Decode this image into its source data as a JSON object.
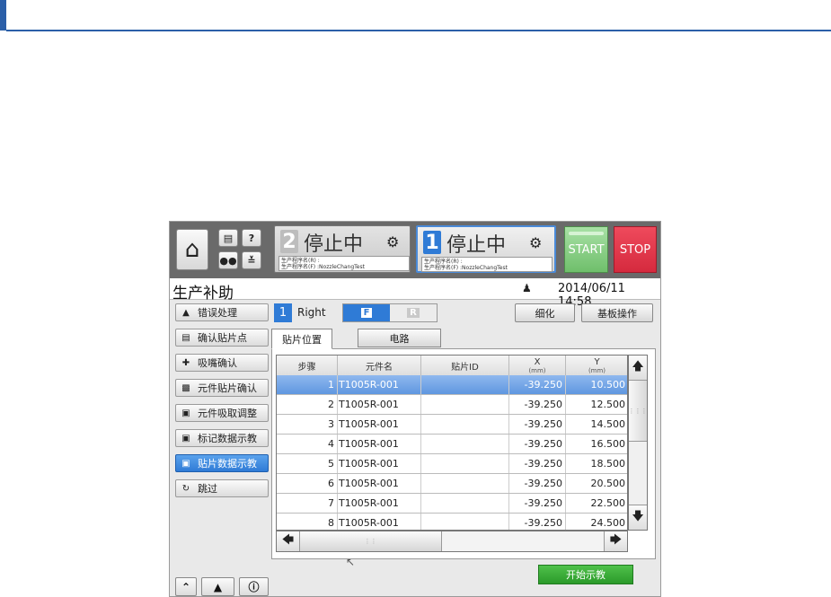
{
  "header": {
    "machine2": {
      "number": "2",
      "status": "停止中",
      "robot_icon": "robot-icon",
      "program_r": "生产程序名(R) :",
      "program_f": "生产程序名(F) :NozzleChangTest"
    },
    "machine1": {
      "number": "1",
      "status": "停止中",
      "robot_icon": "robot-icon",
      "program_r": "生产程序名(R) :",
      "program_f": "生产程序名(F) :NozzleChangTest"
    },
    "start_label": "START",
    "stop_label": "STOP",
    "home_icon": "home-icon",
    "small_buttons": [
      "keyboard-icon",
      "help-icon",
      "operator-icon",
      "network-icon"
    ]
  },
  "title": {
    "page_title": "生产补助",
    "datetime": "2014/06/11 14:58",
    "user_icon": "user-icon"
  },
  "nav": {
    "items": [
      {
        "label": "错误处理",
        "icon": "error-handling-icon"
      },
      {
        "label": "确认贴片点",
        "icon": "confirm-point-icon"
      },
      {
        "label": "吸嘴确认",
        "icon": "nozzle-icon"
      },
      {
        "label": "元件贴片确认",
        "icon": "component-icon"
      },
      {
        "label": "元件吸取调整",
        "icon": "pickup-icon"
      },
      {
        "label": "标记数据示教",
        "icon": "mark-icon"
      },
      {
        "label": "贴片数据示教",
        "icon": "placement-icon"
      },
      {
        "label": "跳过",
        "icon": "skip-icon"
      }
    ],
    "active_index": 6,
    "bottom_buttons": [
      "double-chevron-up-icon",
      "warning-icon",
      "info-icon"
    ]
  },
  "content": {
    "lane_number": "1",
    "lane_label": "Right",
    "front_label": "F",
    "rear_label": "R",
    "detail_button": "细化",
    "board_button": "基板操作",
    "tabs": [
      "贴片位置",
      "电路"
    ],
    "active_tab": 0,
    "teach_button": "开始示教"
  },
  "table": {
    "columns": [
      {
        "label": "步骤",
        "unit": ""
      },
      {
        "label": "元件名",
        "unit": ""
      },
      {
        "label": "贴片ID",
        "unit": ""
      },
      {
        "label": "X",
        "unit": "(mm)"
      },
      {
        "label": "Y",
        "unit": "(mm)"
      }
    ],
    "rows": [
      {
        "step": "1",
        "part": "T1005R-001",
        "id": "",
        "x": "-39.250",
        "y": "10.500"
      },
      {
        "step": "2",
        "part": "T1005R-001",
        "id": "",
        "x": "-39.250",
        "y": "12.500"
      },
      {
        "step": "3",
        "part": "T1005R-001",
        "id": "",
        "x": "-39.250",
        "y": "14.500"
      },
      {
        "step": "4",
        "part": "T1005R-001",
        "id": "",
        "x": "-39.250",
        "y": "16.500"
      },
      {
        "step": "5",
        "part": "T1005R-001",
        "id": "",
        "x": "-39.250",
        "y": "18.500"
      },
      {
        "step": "6",
        "part": "T1005R-001",
        "id": "",
        "x": "-39.250",
        "y": "20.500"
      },
      {
        "step": "7",
        "part": "T1005R-001",
        "id": "",
        "x": "-39.250",
        "y": "22.500"
      },
      {
        "step": "8",
        "part": "T1005R-001",
        "id": "",
        "x": "-39.250",
        "y": "24.500"
      }
    ],
    "selected_index": 0
  },
  "colors": {
    "accent_blue": "#2f7bd6",
    "start_green": "#6fbf6b",
    "stop_red": "#d52a3e",
    "teach_green": "#2b9a2a"
  }
}
